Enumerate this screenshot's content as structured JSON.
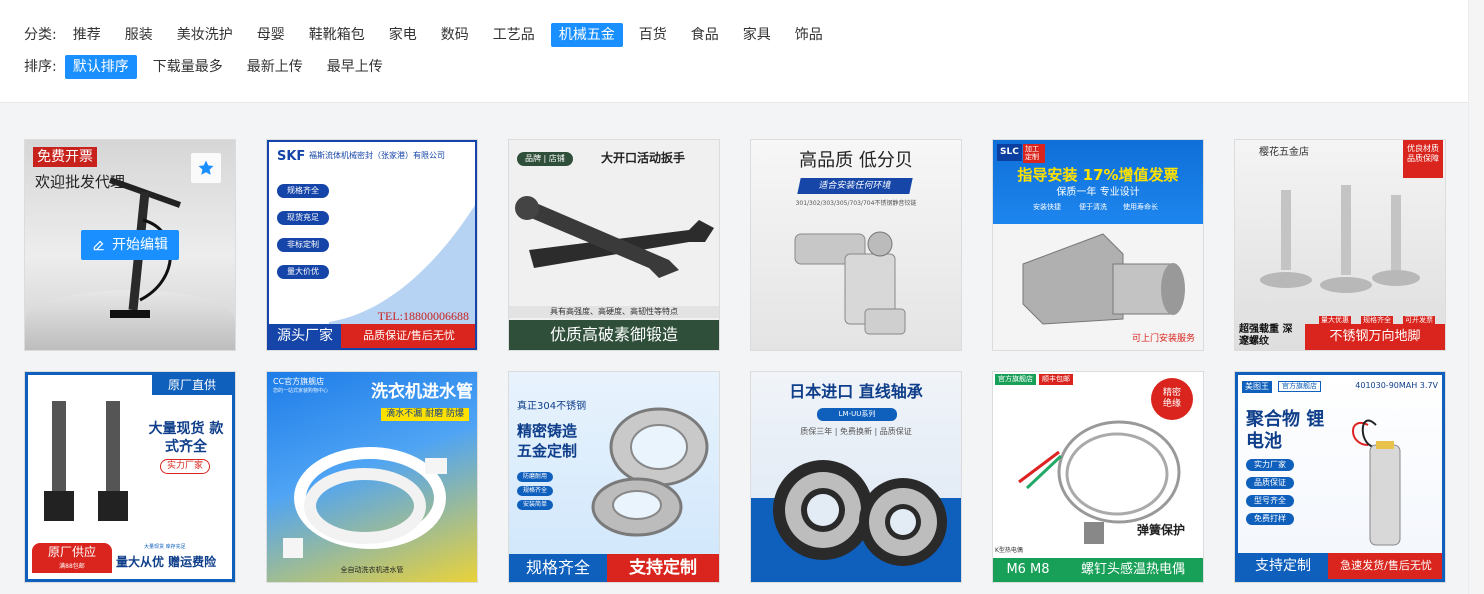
{
  "filters": {
    "category_label": "分类:",
    "categories": [
      "推荐",
      "服装",
      "美妆洗护",
      "母婴",
      "鞋靴箱包",
      "家电",
      "数码",
      "工艺品",
      "机械五金",
      "百货",
      "食品",
      "家具",
      "饰品"
    ],
    "active_category": "机械五金",
    "sort_label": "排序:",
    "sorts": [
      "默认排序",
      "下载量最多",
      "最新上传",
      "最早上传"
    ],
    "active_sort": "默认排序"
  },
  "actions": {
    "edit_label": "开始编辑"
  },
  "colors": {
    "accent": "#1a8fff",
    "red": "#d9251d",
    "blue": "#0a6fd8"
  },
  "templates": [
    {
      "title": "欢迎批发代理",
      "badge": "免费开票"
    },
    {
      "brand": "SKF",
      "company": "福斯流体机械密封（张家港）有限公司",
      "tags": [
        "规格齐全",
        "现货充足",
        "非标定制",
        "量大价优"
      ],
      "phone": "TEL:18800006688",
      "left_banner": "源头厂家",
      "right_banner": "品质保证/售后无忧"
    },
    {
      "tag": "品牌 | 店铺",
      "title": "大开口活动扳手",
      "sub": "具有高强度、高硬度、高韧性等特点",
      "banner": "优质高破素御锻造"
    },
    {
      "title": "高品质 低分贝",
      "ribbon": "适合安装任何环境",
      "models": "301/302/303/305/703/704不锈钢静音铰链"
    },
    {
      "logo": "SLC",
      "logo_tag": "加工定制",
      "headline": "指导安装 17%增值发票",
      "sub": "保质一年 专业设计",
      "checks": [
        "安装快捷",
        "便于清洗",
        "使用寿命长"
      ],
      "footer": "可上门安装服务"
    },
    {
      "shop": "樱花五金店",
      "corner": "优良材质 品质保障",
      "mini_tags": [
        "量大优惠",
        "规格齐全",
        "可开发票"
      ],
      "left_text": "超强载重 深邃螺纹",
      "banner": "不锈钢万向地脚"
    },
    {
      "top": "原厂直供",
      "title": "大量现货 款式齐全",
      "tag": "实力厂家",
      "bottom_badge": "原厂供应",
      "bottom_sub": "满88包邮",
      "bottom_small": "大量现货 库存充足",
      "bottom_text": "量大从优 赠运费险"
    },
    {
      "shop": "CC官方旗舰店",
      "shop_sub": "您的一站式家装购物中心",
      "title": "洗衣机进水管",
      "ribbon": "滴水不漏 耐磨 防爆",
      "footer": "全自动洗衣机进水管"
    },
    {
      "sub": "真正304不锈钢",
      "title": "精密铸造 五金定制",
      "tags": [
        "防磨耐用",
        "规格齐全",
        "安装简单"
      ],
      "banner_left": "规格齐全",
      "banner_right": "支持定制"
    },
    {
      "title": "日本进口 直线轴承",
      "model": "LM-UU系列",
      "sub": "质保三年 | 免费换新 | 品质保证"
    },
    {
      "tag1": "官方旗舰店",
      "tag2": "顺丰包邮",
      "circle": "精密 绝缘",
      "label": "弹簧保护",
      "type_tag": "K型热电偶",
      "left": "M6 M8",
      "right": "螺钉头感温热电偶"
    },
    {
      "brand1": "美图王",
      "brand2": "官方旗舰店",
      "model": "401030-90MAH 3.7V",
      "title": "聚合物 锂电池",
      "tags": [
        "实力厂家",
        "品质保证",
        "型号齐全",
        "免费打样"
      ],
      "banner_left": "支持定制",
      "banner_right": "急速发货/售后无忧"
    }
  ]
}
